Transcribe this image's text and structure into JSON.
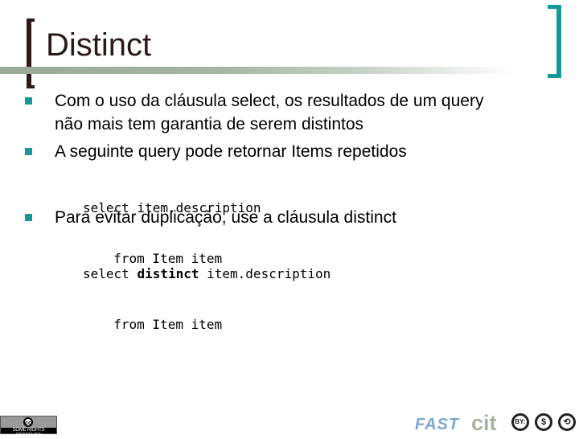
{
  "slide": {
    "title": "Distinct",
    "bullets": [
      {
        "lines": [
          "Com o uso da cláusula select, os resultados de um query",
          "não mais tem garantia de serem distintos"
        ]
      },
      {
        "lines": [
          "A seguinte query pode retornar Items repetidos"
        ]
      },
      {
        "lines": [
          "Para evitar duplicação, use a cláusula distinct"
        ]
      }
    ],
    "code_blocks": [
      {
        "line1": "select item.description",
        "line2": "  from Item item"
      },
      {
        "line1_prefix": "select ",
        "line1_keyword": "distinct",
        "line1_suffix": " item.description",
        "line2": "  from Item item"
      }
    ]
  },
  "footer": {
    "cc_badge_symbol": "cc",
    "cc_badge_text": "SOME RIGHTS RESERVED",
    "logos": [
      "FAST",
      "cit"
    ],
    "license_icons": [
      {
        "name": "by-icon",
        "glyph": "BY:"
      },
      {
        "name": "non-commercial-icon",
        "glyph": "$"
      },
      {
        "name": "share-alike-icon",
        "glyph": "⟲"
      }
    ]
  },
  "colors": {
    "accent": "#17999a",
    "title": "#2b1a1a",
    "rule": "#9aaa99"
  }
}
